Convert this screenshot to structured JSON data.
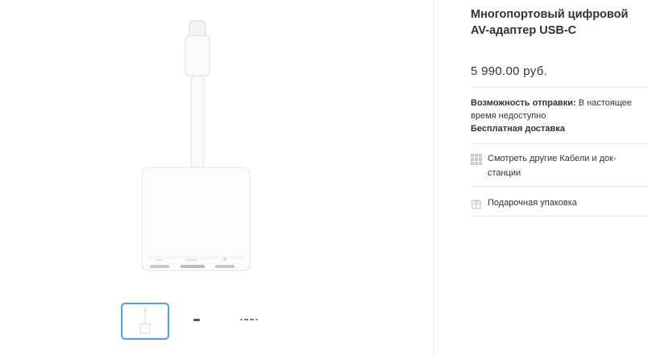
{
  "product": {
    "title": "Многопортовый цифровой AV-адаптер USB-C",
    "price": "5 990.00 руб."
  },
  "shipping": {
    "label": "Возможность отправки:",
    "value": "В настоящее время недоступно",
    "free_delivery": "Бесплатная доставка"
  },
  "links": {
    "more_cables": "Смотреть другие Кабели и док-станции",
    "gift_wrap": "Подарочная упаковка"
  },
  "icons": {
    "more_cables": "grid-icon",
    "gift_wrap": "gift-icon"
  },
  "gallery": {
    "selected_index": 0,
    "selection_color": "#4d9ee3"
  }
}
